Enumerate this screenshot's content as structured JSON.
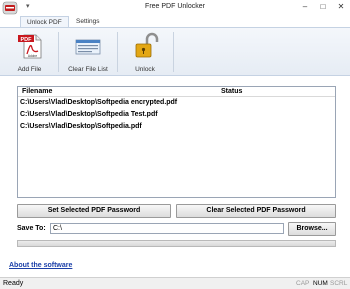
{
  "window": {
    "title": "Free PDF Unlocker",
    "qat_symbol": "▾"
  },
  "tabs": [
    {
      "label": "Unlock PDF"
    },
    {
      "label": "Settings"
    }
  ],
  "ribbon": {
    "add_file": "Add File",
    "clear_list": "Clear File List",
    "unlock": "Unlock"
  },
  "list": {
    "columns": {
      "filename": "Filename",
      "status": "Status"
    },
    "rows": [
      {
        "filename": "C:\\Users\\Vlad\\Desktop\\Softpedia encrypted.pdf",
        "status": ""
      },
      {
        "filename": "C:\\Users\\Vlad\\Desktop\\Softpedia Test.pdf",
        "status": ""
      },
      {
        "filename": "C:\\Users\\Vlad\\Desktop\\Softpedia.pdf",
        "status": ""
      }
    ]
  },
  "buttons": {
    "set_password": "Set Selected PDF Password",
    "clear_password": "Clear Selected PDF Password",
    "browse": "Browse..."
  },
  "save_to": {
    "label": "Save To:",
    "value": "C:\\"
  },
  "progress": {
    "value": 0
  },
  "about_link": "About the software",
  "statusbar": {
    "text": "Ready",
    "cap": "CAP",
    "num": "NUM",
    "scrl": "SCRL"
  },
  "icons": {
    "app": "pdf-lock-app-icon",
    "add": "pdf-file-icon",
    "clear": "file-list-icon",
    "unlock": "open-padlock-icon"
  }
}
